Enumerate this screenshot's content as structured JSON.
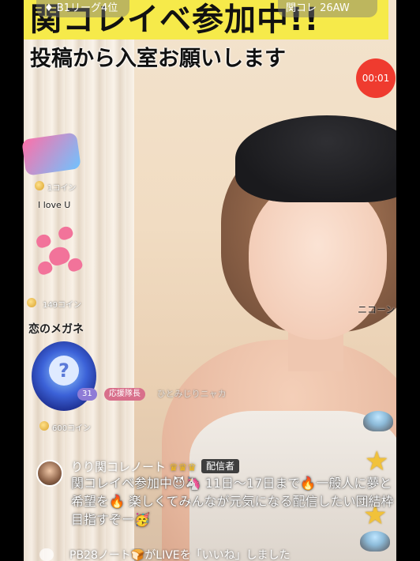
{
  "header": {
    "banner_main": "関コレイベ参加中!!",
    "banner_sub": "投稿から入室お願いします",
    "rank_pill": "B1リーグ4位",
    "event_pill": "関コレ 26AW",
    "timer": "00:01"
  },
  "left_gifts": {
    "gift1_label": "1コイン",
    "gift2_title": "I love U",
    "gift3_label": "149コイン",
    "gift4_title": "恋のメガネ",
    "gift5_label": "600コイン"
  },
  "right_panel": {
    "tag_text": "ニコーン"
  },
  "viewer_row": {
    "level": "31",
    "guard_label": "応援隊長",
    "username": "ひとみじりニャカ"
  },
  "comment": {
    "author": "りり関コレノート",
    "host_badge": "配信者",
    "text": "関コレイベ参加中😈🦄 11日〜17日まで🔥一般人に夢と希望を🔥 楽しくてみんなが元気になる配信したい団結枠目指すぞー🥳"
  },
  "footer": {
    "bottom_text": "PB28ノート🍞がLIVEを「いいね」しました"
  },
  "colors": {
    "banner_yellow": "#f6ea4a",
    "timer_red": "#ef3b2f",
    "host_badge_bg": "#3e3e3e"
  }
}
